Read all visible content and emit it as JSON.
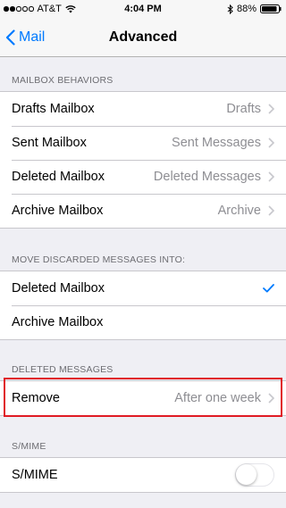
{
  "status_bar": {
    "carrier": "AT&T",
    "signal_bars": 2,
    "time": "4:04 PM",
    "battery": "88%"
  },
  "nav": {
    "back_label": "Mail",
    "title": "Advanced"
  },
  "mailbox_behaviors": {
    "header": "MAILBOX BEHAVIORS",
    "rows": [
      {
        "label": "Drafts Mailbox",
        "value": "Drafts"
      },
      {
        "label": "Sent Mailbox",
        "value": "Sent Messages"
      },
      {
        "label": "Deleted Mailbox",
        "value": "Deleted Messages"
      },
      {
        "label": "Archive Mailbox",
        "value": "Archive"
      }
    ]
  },
  "move_discarded": {
    "header": "MOVE DISCARDED MESSAGES INTO:",
    "rows": [
      {
        "label": "Deleted Mailbox",
        "checked": true
      },
      {
        "label": "Archive Mailbox",
        "checked": false
      }
    ]
  },
  "deleted_messages": {
    "header": "DELETED MESSAGES",
    "rows": [
      {
        "label": "Remove",
        "value": "After one week"
      }
    ]
  },
  "smime": {
    "header": "S/MIME",
    "rows": [
      {
        "label": "S/MIME",
        "enabled": false
      }
    ]
  },
  "colors": {
    "accent": "#007aff",
    "highlight": "#e01b24",
    "background": "#efeff4"
  }
}
